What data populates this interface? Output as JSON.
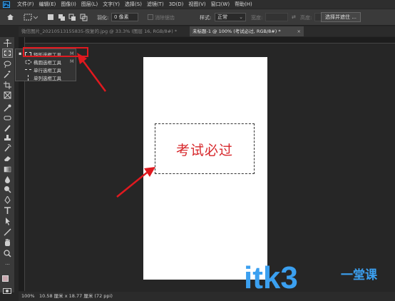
{
  "menubar": {
    "logo": "Ps",
    "items": [
      "文件(F)",
      "编辑(E)",
      "图像(I)",
      "图层(L)",
      "文字(Y)",
      "选择(S)",
      "滤镜(T)",
      "3D(D)",
      "视图(V)",
      "窗口(W)",
      "帮助(H)"
    ]
  },
  "options": {
    "feather_label": "羽化:",
    "feather_value": "0 像素",
    "antialias_label": "消除锯齿",
    "style_label": "样式:",
    "style_value": "正常",
    "width_label": "宽度:",
    "height_label": "高度:",
    "select_mask_button": "选择并遮住 ..."
  },
  "tabs": [
    {
      "label": "微信图片_20210513155835-恢复的.jpg @ 33.3% (图层 16, RGB/8#) *"
    },
    {
      "label": "未标题-1 @ 100% (考试必过, RGB/8#) *"
    }
  ],
  "flyout": {
    "items": [
      {
        "label": "矩形选框工具",
        "shortcut": "M",
        "icon": "rect-marquee-icon"
      },
      {
        "label": "椭圆选框工具",
        "shortcut": "M",
        "icon": "ellipse-marquee-icon"
      },
      {
        "label": "单行选框工具",
        "shortcut": "",
        "icon": "single-row-marquee-icon"
      },
      {
        "label": "单列选框工具",
        "shortcut": "",
        "icon": "single-column-marquee-icon"
      }
    ]
  },
  "canvas": {
    "text": "考试必过",
    "text_color": "#d7262a"
  },
  "statusbar": {
    "zoom": "100%",
    "doc_info": "10.58 厘米 x 18.77 厘米 (72 ppi)"
  },
  "watermark": {
    "text": "itk3",
    "cn_text": "一堂课",
    "color": "#3ba0f0"
  },
  "annotation_color": "#e0191f"
}
